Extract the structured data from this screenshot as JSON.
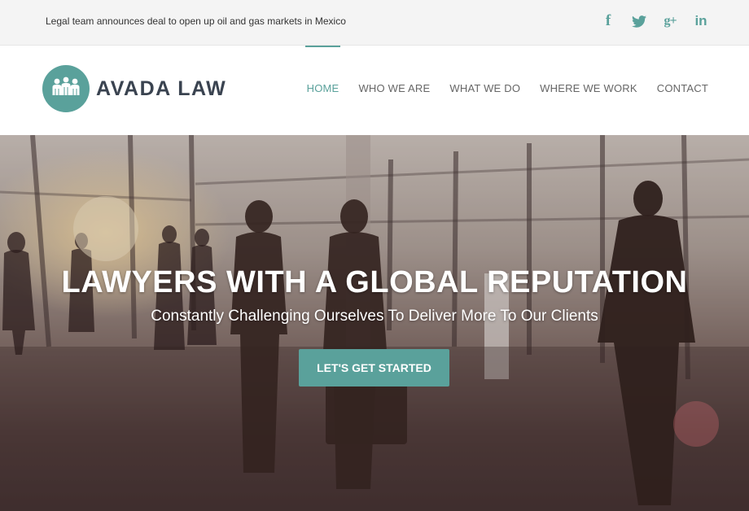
{
  "topbar": {
    "news_text": "Legal team announces deal to open up oil and gas markets in Mexico",
    "social": [
      {
        "name": "facebook-icon",
        "glyph": "f"
      },
      {
        "name": "twitter-icon",
        "glyph": "🐦"
      },
      {
        "name": "google-plus-icon",
        "glyph": "g+"
      },
      {
        "name": "linkedin-icon",
        "glyph": "in"
      }
    ]
  },
  "header": {
    "logo_text": "AVADA LAW",
    "nav": [
      {
        "label": "HOME",
        "active": true
      },
      {
        "label": "WHO WE ARE",
        "active": false
      },
      {
        "label": "WHAT WE DO",
        "active": false
      },
      {
        "label": "WHERE WE WORK",
        "active": false
      },
      {
        "label": "CONTACT",
        "active": false
      }
    ]
  },
  "hero": {
    "title": "LAWYERS WITH A GLOBAL REPUTATION",
    "subtitle": "Constantly Challenging Ourselves To Deliver More To Our Clients",
    "cta_label": "LET'S GET STARTED"
  },
  "colors": {
    "accent": "#5aa19b",
    "logo_text": "#3a4350",
    "topbar_bg": "#f4f4f4"
  }
}
